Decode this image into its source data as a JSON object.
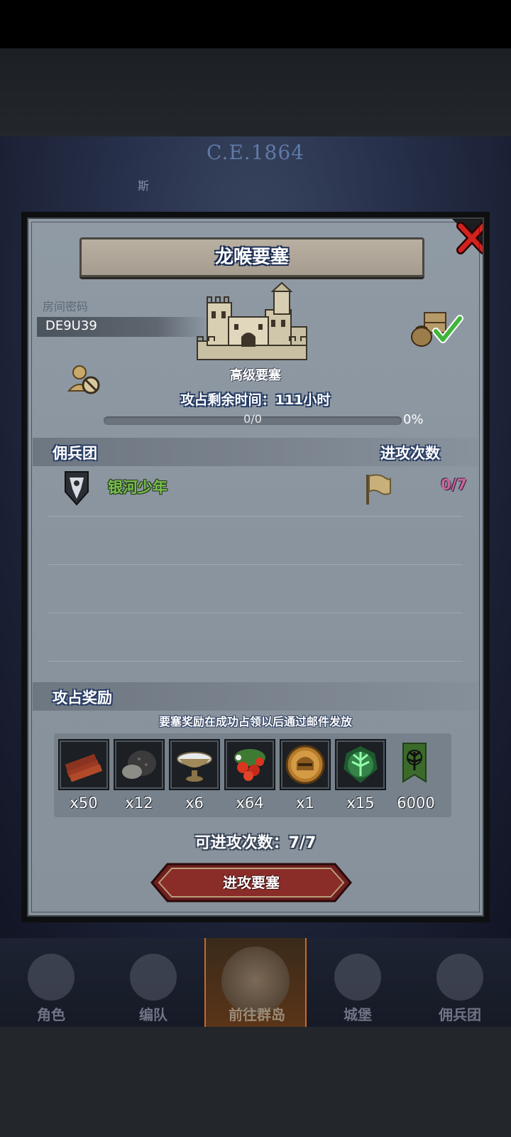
{
  "background": {
    "year_text": "C.E.1864",
    "fragment_text": "斯"
  },
  "bottom_nav": {
    "items": [
      {
        "label": "角色",
        "icon": "knight-helmet-icon"
      },
      {
        "label": "编队",
        "icon": "team-formation-icon"
      },
      {
        "label": "前往群岛",
        "icon": "islands-compass-icon",
        "active": true
      },
      {
        "label": "城堡",
        "icon": "castle-icon"
      },
      {
        "label": "佣兵团",
        "icon": "mercenary-icon"
      }
    ]
  },
  "dialog": {
    "title": "龙喉要塞",
    "room_password_label": "房间密码",
    "room_code": "DE9U39",
    "fortress_type": "高级要塞",
    "remaining_time": "攻占剩余时间：111小时",
    "progress": {
      "text": "0/0",
      "percent": "0%",
      "fraction": 0
    },
    "mercenary_header": "佣兵团",
    "attack_count_header": "进攻次数",
    "guilds": [
      {
        "name": "银河少年",
        "attacks": "0/7"
      }
    ],
    "rewards_header": "攻占奖励",
    "reward_note": "要塞奖励在成功占领以后通过邮件发放",
    "rewards": [
      {
        "icon": "wood-planks-icon",
        "qty": "x50"
      },
      {
        "icon": "ore-stone-icon",
        "qty": "x12"
      },
      {
        "icon": "milk-bowl-icon",
        "qty": "x6"
      },
      {
        "icon": "berries-icon",
        "qty": "x64"
      },
      {
        "icon": "golden-helmet-medal-icon",
        "qty": "x1"
      },
      {
        "icon": "green-tree-crystal-icon",
        "qty": "x15"
      },
      {
        "icon": "guild-banner-icon",
        "qty": "6000"
      }
    ],
    "remaining_attacks": "可进攻次数：7/7",
    "attack_button": "进攻要塞"
  },
  "colors": {
    "accent_title_outline": "#1a2c52",
    "guild_name": "#78c04c",
    "attack_count": "#c7679b",
    "button_red": "#7a2222"
  }
}
